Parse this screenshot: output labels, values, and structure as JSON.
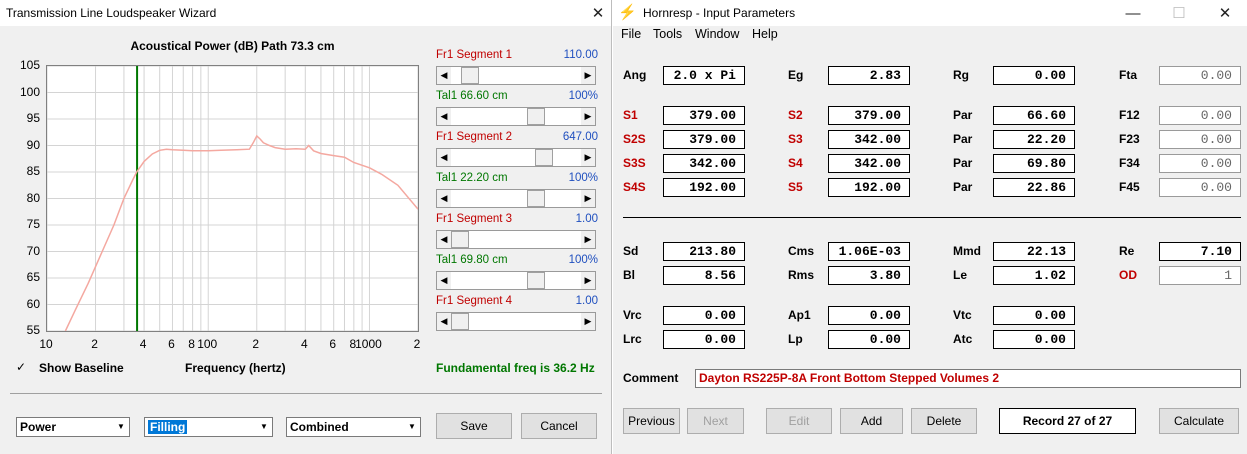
{
  "wizard": {
    "title": "Transmission Line Loudspeaker Wizard",
    "close": "✕",
    "chart_title": "Acoustical Power (dB)   Path 73.3 cm",
    "segments": [
      {
        "name": "Fr1  Segment 1",
        "value": "110.00",
        "thumb": 0.08
      },
      {
        "name": "Tal1  66.60 cm",
        "value": "100%",
        "thumb": 0.6
      },
      {
        "name": "Fr1  Segment 2",
        "value": "647.00",
        "thumb": 0.67
      },
      {
        "name": "Tal1  22.20 cm",
        "value": "100%",
        "thumb": 0.6
      },
      {
        "name": "Fr1  Segment 3",
        "value": "1.00",
        "thumb": 0.0
      },
      {
        "name": "Tal1  69.80 cm",
        "value": "100%",
        "thumb": 0.6
      },
      {
        "name": "Fr1  Segment 4",
        "value": "1.00",
        "thumb": 0.0
      }
    ],
    "show_baseline_label": "Show Baseline",
    "show_baseline_checked": "✓",
    "xlabel": "Frequency (hertz)",
    "fundamental": "Fundamental freq is 36.2 Hz",
    "dropdowns": [
      "Power",
      "Filling",
      "Combined"
    ],
    "save": "Save",
    "cancel": "Cancel",
    "colors": {
      "curve": "#f4a8a0",
      "marker": "#007700",
      "fundamental": "#007700"
    }
  },
  "chart_data": {
    "type": "line",
    "title": "Acoustical Power (dB)   Path 73.3 cm",
    "xlabel": "Frequency (hertz)",
    "ylabel": "",
    "xscale": "log",
    "xlim": [
      10,
      2000
    ],
    "ylim": [
      55,
      105
    ],
    "yticks": [
      105,
      100,
      95,
      90,
      85,
      80,
      75,
      70,
      65,
      60,
      55
    ],
    "xticklabels": [
      "10",
      "2",
      "4",
      "6",
      "8",
      "100",
      "2",
      "4",
      "6",
      "8",
      "1000",
      "2"
    ],
    "marker_x": 36.2,
    "grid": true,
    "series": [
      {
        "x": [
          13,
          15,
          18,
          22,
          26,
          30,
          34,
          36,
          40,
          45,
          50,
          55,
          60,
          70,
          80,
          100,
          120,
          150,
          180,
          190,
          200,
          210,
          220,
          240,
          260,
          300,
          350,
          400,
          420,
          450,
          500,
          600,
          700,
          800,
          1000,
          1200,
          1500,
          2000
        ],
        "y": [
          55,
          59,
          64,
          70,
          75,
          80,
          83.5,
          85,
          87,
          88.4,
          89.1,
          89.3,
          89.2,
          89.1,
          89.0,
          89.0,
          89.1,
          89.2,
          89.3,
          90.5,
          91.8,
          91.2,
          90.5,
          90.0,
          89.6,
          89.3,
          89.4,
          89.3,
          90.0,
          89.0,
          88.5,
          88.1,
          87.8,
          86.8,
          85.8,
          84.5,
          82.5,
          78
        ]
      }
    ]
  },
  "hornresp": {
    "title": "Hornresp - Input Parameters",
    "logo": "⚡",
    "controls": [
      "—",
      "☐",
      "✕"
    ],
    "menu": [
      "File",
      "Tools",
      "Window",
      "Help"
    ],
    "rows": [
      [
        {
          "l": "Ang",
          "v": "2.0 x Pi",
          "c": "black"
        },
        {
          "l": "Eg",
          "v": "2.83",
          "c": "black"
        },
        {
          "l": "Rg",
          "v": "0.00",
          "c": "black"
        },
        {
          "l": "Fta",
          "v": "0.00",
          "c": "black",
          "g": true
        }
      ],
      [
        {
          "l": "S1",
          "v": "379.00",
          "c": "red"
        },
        {
          "l": "S2",
          "v": "379.00",
          "c": "red"
        },
        {
          "l": "Par",
          "v": "66.60",
          "c": "black"
        },
        {
          "l": "F12",
          "v": "0.00",
          "c": "black",
          "g": true
        }
      ],
      [
        {
          "l": "S2S",
          "v": "379.00",
          "c": "red"
        },
        {
          "l": "S3",
          "v": "342.00",
          "c": "red"
        },
        {
          "l": "Par",
          "v": "22.20",
          "c": "black"
        },
        {
          "l": "F23",
          "v": "0.00",
          "c": "black",
          "g": true
        }
      ],
      [
        {
          "l": "S3S",
          "v": "342.00",
          "c": "red"
        },
        {
          "l": "S4",
          "v": "342.00",
          "c": "red"
        },
        {
          "l": "Par",
          "v": "69.80",
          "c": "black"
        },
        {
          "l": "F34",
          "v": "0.00",
          "c": "black",
          "g": true
        }
      ],
      [
        {
          "l": "S4S",
          "v": "192.00",
          "c": "red"
        },
        {
          "l": "S5",
          "v": "192.00",
          "c": "red"
        },
        {
          "l": "Par",
          "v": "22.86",
          "c": "black"
        },
        {
          "l": "F45",
          "v": "0.00",
          "c": "black",
          "g": true
        }
      ],
      [
        {
          "l": "Sd",
          "v": "213.80",
          "c": "black"
        },
        {
          "l": "Cms",
          "v": "1.06E-03",
          "c": "black"
        },
        {
          "l": "Mmd",
          "v": "22.13",
          "c": "black"
        },
        {
          "l": "Re",
          "v": "7.10",
          "c": "black"
        }
      ],
      [
        {
          "l": "Bl",
          "v": "8.56",
          "c": "black"
        },
        {
          "l": "Rms",
          "v": "3.80",
          "c": "black"
        },
        {
          "l": "Le",
          "v": "1.02",
          "c": "black"
        },
        {
          "l": "OD",
          "v": "1",
          "c": "red",
          "g": true
        }
      ],
      [
        {
          "l": "Vrc",
          "v": "0.00",
          "c": "black"
        },
        {
          "l": "Ap1",
          "v": "0.00",
          "c": "black"
        },
        {
          "l": "Vtc",
          "v": "0.00",
          "c": "black"
        }
      ],
      [
        {
          "l": "Lrc",
          "v": "0.00",
          "c": "black"
        },
        {
          "l": "Lp",
          "v": "0.00",
          "c": "black"
        },
        {
          "l": "Atc",
          "v": "0.00",
          "c": "black"
        }
      ]
    ],
    "comment_label": "Comment",
    "comment": "Dayton RS225P-8A Front Bottom Stepped Volumes 2",
    "buttons": {
      "previous": "Previous",
      "next": "Next",
      "edit": "Edit",
      "add": "Add",
      "delete": "Delete",
      "calculate": "Calculate"
    },
    "record": "Record 27 of 27"
  }
}
